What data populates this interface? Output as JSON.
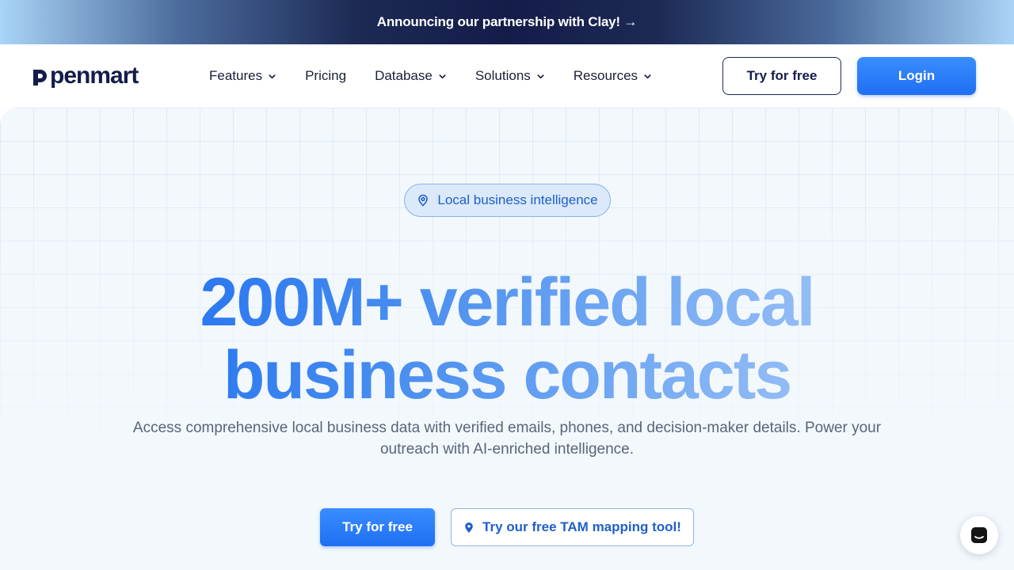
{
  "announcement": {
    "text": "Announcing our partnership with Clay! →"
  },
  "header": {
    "logo_text": "penmart",
    "nav": [
      {
        "label": "Features",
        "has_dropdown": true
      },
      {
        "label": "Pricing",
        "has_dropdown": false
      },
      {
        "label": "Database",
        "has_dropdown": true
      },
      {
        "label": "Solutions",
        "has_dropdown": true
      },
      {
        "label": "Resources",
        "has_dropdown": true
      }
    ],
    "try_free_label": "Try for free",
    "login_label": "Login"
  },
  "hero": {
    "badge_text": "Local business intelligence",
    "headline_line1": "200M+ verified local",
    "headline_line2": "business contacts",
    "subtext": "Access comprehensive local business data with verified emails, phones, and decision-maker details. Power your outreach with AI-enriched intelligence.",
    "primary_cta": "Try for free",
    "secondary_cta": "Try our free TAM mapping tool!"
  },
  "icons": {
    "dropdown": "chevron-down-icon",
    "badge": "map-pin-icon",
    "cta": "map-pin-icon",
    "chat": "chat-icon"
  },
  "colors": {
    "brand_navy": "#141c4a",
    "accent_blue": "#1f6ff2",
    "hero_bg": "#f3f8fd"
  }
}
